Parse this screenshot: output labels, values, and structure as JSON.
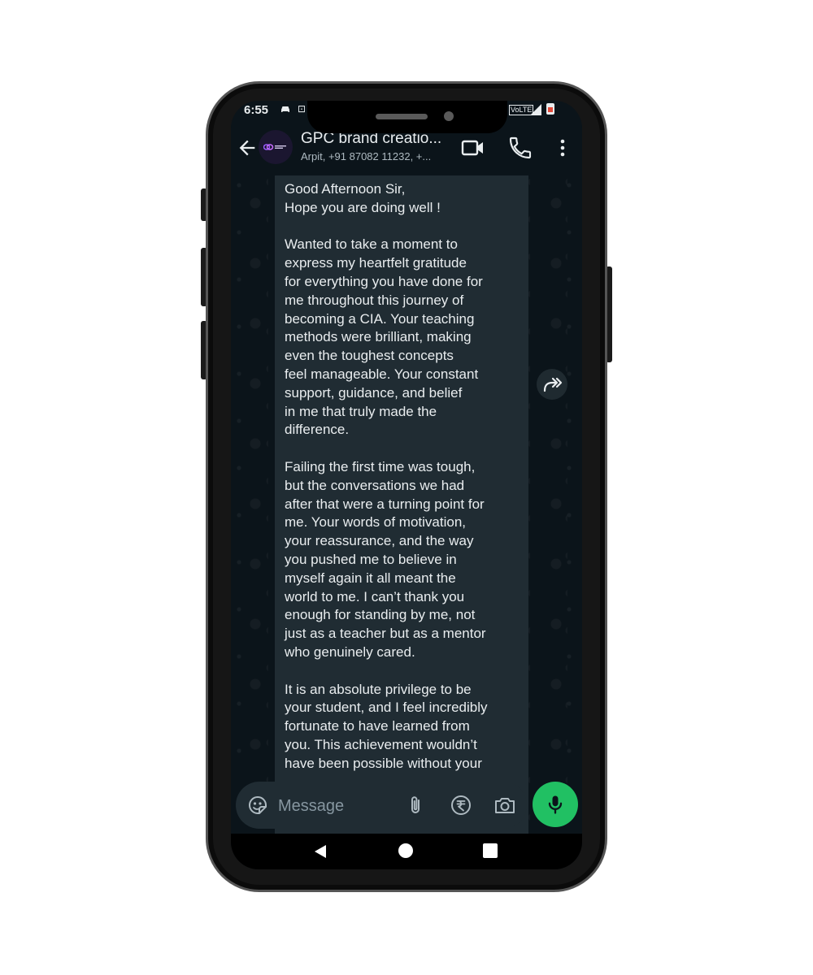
{
  "status_bar": {
    "time": "6:55",
    "car_icon": "car-icon",
    "extra_glyph": "⊡",
    "volte": "VoLTE",
    "signal_icon": "signal-icon",
    "battery_icon": "battery-icon"
  },
  "header": {
    "group_name": "GPC brand creatio...",
    "members": "Arpit, +91 87082 11232, +...",
    "icons": [
      "back-arrow-icon",
      "video-call-icon",
      "voice-call-icon",
      "more-vertical-icon"
    ]
  },
  "message": {
    "paragraphs": [
      "Good Afternoon Sir,\nHope you are doing well !",
      "Wanted to take a moment to\nexpress my heartfelt gratitude\nfor everything you have done for\nme throughout this journey of\nbecoming a CIA. Your teaching\nmethods were brilliant, making\neven the toughest concepts\nfeel manageable. Your constant\nsupport, guidance, and belief\nin me that truly made the\ndifference.",
      "Failing the first time was tough,\nbut the conversations we had\nafter that were a turning point for\nme. Your words of motivation,\nyour reassurance, and the way\nyou pushed me to believe in\nmyself again it all meant the\nworld to me. I can’t thank you\nenough for standing by me, not\njust as a teacher but as a mentor\nwho genuinely cared.",
      "It is an absolute privilege to be\nyour student, and I feel incredibly\nfortunate to have learned from\nyou. This achievement wouldn’t\nhave been possible without your"
    ],
    "forward_icon": "forward-icon"
  },
  "composer": {
    "placeholder": "Message",
    "icons": [
      "sticker-icon",
      "attachment-icon",
      "rupee-icon",
      "camera-icon",
      "mic-icon"
    ]
  },
  "colors": {
    "background": "#0b141a",
    "bubble": "#202c33",
    "text": "#e9edef",
    "accent": "#21c063"
  }
}
